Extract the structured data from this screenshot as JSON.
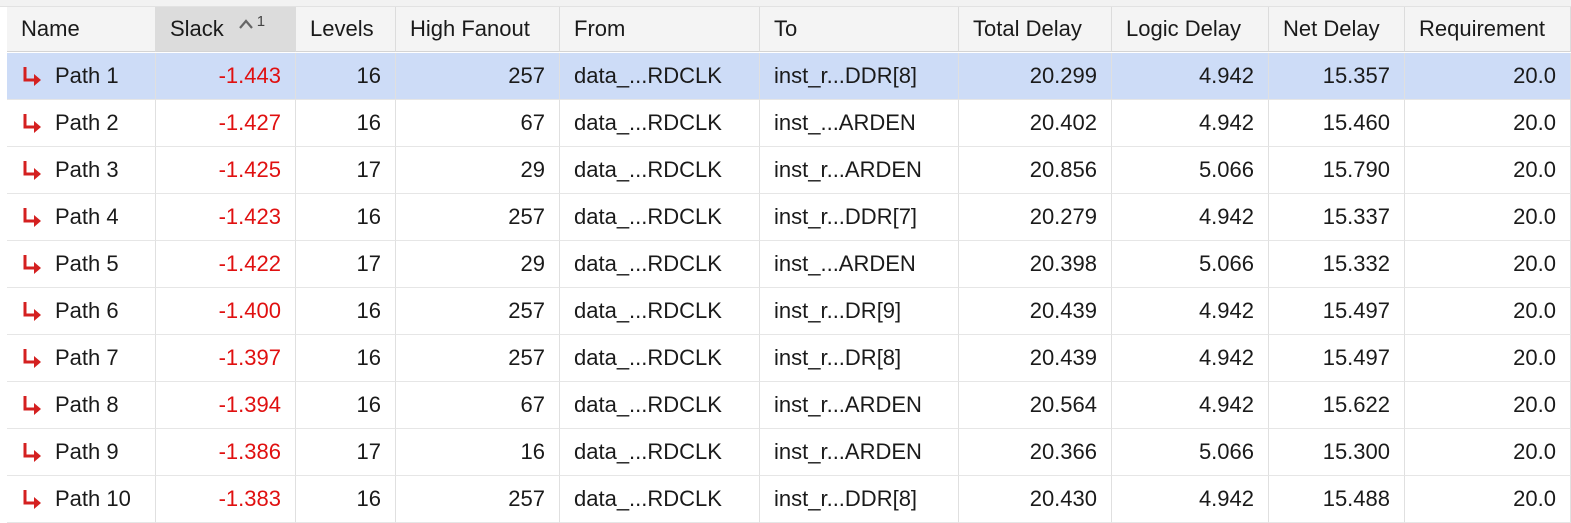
{
  "columns": {
    "name": "Name",
    "slack": "Slack",
    "slack_sort_rank": "1",
    "levels": "Levels",
    "high_fanout": "High Fanout",
    "from": "From",
    "to": "To",
    "total_delay": "Total Delay",
    "logic_delay": "Logic Delay",
    "net_delay": "Net Delay",
    "requirement": "Requirement"
  },
  "sort": {
    "column": "slack",
    "direction": "ascending"
  },
  "colors": {
    "slack_negative": "#e01010",
    "selected_row": "#cddcf7",
    "path_icon": "#d42020"
  },
  "rows": [
    {
      "name": "Path 1",
      "slack": "-1.443",
      "levels": "16",
      "high_fanout": "257",
      "from": "data_...RDCLK",
      "to": "inst_r...DDR[8]",
      "total_delay": "20.299",
      "logic_delay": "4.942",
      "net_delay": "15.357",
      "requirement": "20.0",
      "selected": true
    },
    {
      "name": "Path 2",
      "slack": "-1.427",
      "levels": "16",
      "high_fanout": "67",
      "from": "data_...RDCLK",
      "to": "inst_...ARDEN",
      "total_delay": "20.402",
      "logic_delay": "4.942",
      "net_delay": "15.460",
      "requirement": "20.0",
      "selected": false
    },
    {
      "name": "Path 3",
      "slack": "-1.425",
      "levels": "17",
      "high_fanout": "29",
      "from": "data_...RDCLK",
      "to": "inst_r...ARDEN",
      "total_delay": "20.856",
      "logic_delay": "5.066",
      "net_delay": "15.790",
      "requirement": "20.0",
      "selected": false
    },
    {
      "name": "Path 4",
      "slack": "-1.423",
      "levels": "16",
      "high_fanout": "257",
      "from": "data_...RDCLK",
      "to": "inst_r...DDR[7]",
      "total_delay": "20.279",
      "logic_delay": "4.942",
      "net_delay": "15.337",
      "requirement": "20.0",
      "selected": false
    },
    {
      "name": "Path 5",
      "slack": "-1.422",
      "levels": "17",
      "high_fanout": "29",
      "from": "data_...RDCLK",
      "to": "inst_...ARDEN",
      "total_delay": "20.398",
      "logic_delay": "5.066",
      "net_delay": "15.332",
      "requirement": "20.0",
      "selected": false
    },
    {
      "name": "Path 6",
      "slack": "-1.400",
      "levels": "16",
      "high_fanout": "257",
      "from": "data_...RDCLK",
      "to": "inst_r...DR[9]",
      "total_delay": "20.439",
      "logic_delay": "4.942",
      "net_delay": "15.497",
      "requirement": "20.0",
      "selected": false
    },
    {
      "name": "Path 7",
      "slack": "-1.397",
      "levels": "16",
      "high_fanout": "257",
      "from": "data_...RDCLK",
      "to": "inst_r...DR[8]",
      "total_delay": "20.439",
      "logic_delay": "4.942",
      "net_delay": "15.497",
      "requirement": "20.0",
      "selected": false
    },
    {
      "name": "Path 8",
      "slack": "-1.394",
      "levels": "16",
      "high_fanout": "67",
      "from": "data_...RDCLK",
      "to": "inst_r...ARDEN",
      "total_delay": "20.564",
      "logic_delay": "4.942",
      "net_delay": "15.622",
      "requirement": "20.0",
      "selected": false
    },
    {
      "name": "Path 9",
      "slack": "-1.386",
      "levels": "17",
      "high_fanout": "16",
      "from": "data_...RDCLK",
      "to": "inst_r...ARDEN",
      "total_delay": "20.366",
      "logic_delay": "5.066",
      "net_delay": "15.300",
      "requirement": "20.0",
      "selected": false
    },
    {
      "name": "Path 10",
      "slack": "-1.383",
      "levels": "16",
      "high_fanout": "257",
      "from": "data_...RDCLK",
      "to": "inst_r...DDR[8]",
      "total_delay": "20.430",
      "logic_delay": "4.942",
      "net_delay": "15.488",
      "requirement": "20.0",
      "selected": false
    }
  ]
}
